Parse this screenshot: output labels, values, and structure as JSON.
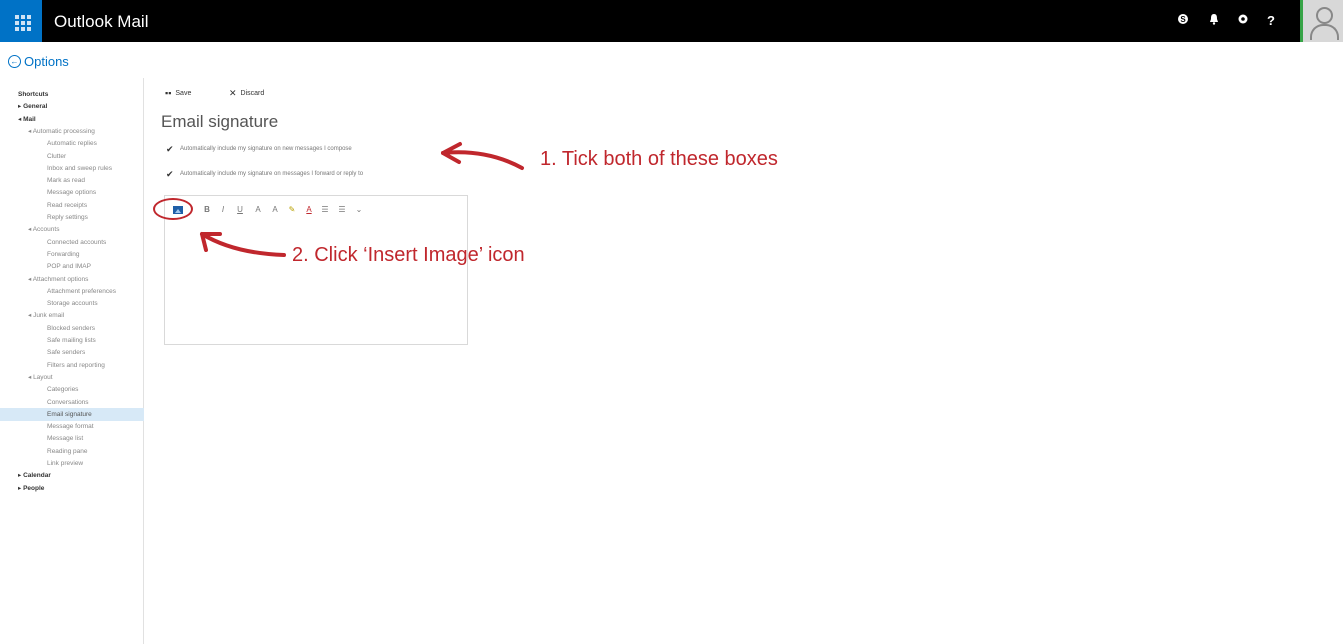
{
  "app": {
    "title": "Outlook Mail"
  },
  "topbar_icons": [
    "skype-icon",
    "bell-icon",
    "gear-icon",
    "help-icon"
  ],
  "topbar_help_glyph": "?",
  "options_label": "Options",
  "sidebar": {
    "items": [
      {
        "label": "Shortcuts",
        "level": 0
      },
      {
        "label": "▸ General",
        "level": 0
      },
      {
        "label": "◂ Mail",
        "level": 0
      },
      {
        "label": "◂ Automatic processing",
        "level": 1
      },
      {
        "label": "Automatic replies",
        "level": 3
      },
      {
        "label": "Clutter",
        "level": 3
      },
      {
        "label": "Inbox and sweep rules",
        "level": 3
      },
      {
        "label": "Mark as read",
        "level": 3
      },
      {
        "label": "Message options",
        "level": 3
      },
      {
        "label": "Read receipts",
        "level": 3
      },
      {
        "label": "Reply settings",
        "level": 3
      },
      {
        "label": "◂ Accounts",
        "level": 1
      },
      {
        "label": "Connected accounts",
        "level": 3
      },
      {
        "label": "Forwarding",
        "level": 3
      },
      {
        "label": "POP and IMAP",
        "level": 3
      },
      {
        "label": "◂ Attachment options",
        "level": 1
      },
      {
        "label": "Attachment preferences",
        "level": 3
      },
      {
        "label": "Storage accounts",
        "level": 3
      },
      {
        "label": "◂ Junk email",
        "level": 1
      },
      {
        "label": "Blocked senders",
        "level": 3
      },
      {
        "label": "Safe mailing lists",
        "level": 3
      },
      {
        "label": "Safe senders",
        "level": 3
      },
      {
        "label": "Filters and reporting",
        "level": 3
      },
      {
        "label": "◂ Layout",
        "level": 1
      },
      {
        "label": "Categories",
        "level": 3
      },
      {
        "label": "Conversations",
        "level": 3
      },
      {
        "label": "Email signature",
        "level": 3,
        "selected": true
      },
      {
        "label": "Message format",
        "level": 3
      },
      {
        "label": "Message list",
        "level": 3
      },
      {
        "label": "Reading pane",
        "level": 3
      },
      {
        "label": "Link preview",
        "level": 3
      },
      {
        "label": "▸ Calendar",
        "level": 0
      },
      {
        "label": "▸ People",
        "level": 0
      }
    ]
  },
  "toolbar": {
    "save_label": "Save",
    "discard_label": "Discard"
  },
  "main": {
    "title": "Email signature",
    "checkboxes": [
      {
        "label": "Automatically include my signature on new messages I compose",
        "checked": true
      },
      {
        "label": "Automatically include my signature on messages I forward or reply to",
        "checked": true
      }
    ],
    "editor_tools": [
      "insert-image",
      "bold",
      "italic",
      "underline",
      "font-size",
      "font-shrink",
      "highlight",
      "font-color",
      "bullets",
      "numbering",
      "more"
    ]
  },
  "annotations": {
    "step1": "1. Tick both of these boxes",
    "step2": "2. Click ‘Insert Image’ icon"
  },
  "colors": {
    "accent": "#0072c6",
    "annotation": "#c0272d",
    "selected_bg": "#d7e9f7"
  }
}
